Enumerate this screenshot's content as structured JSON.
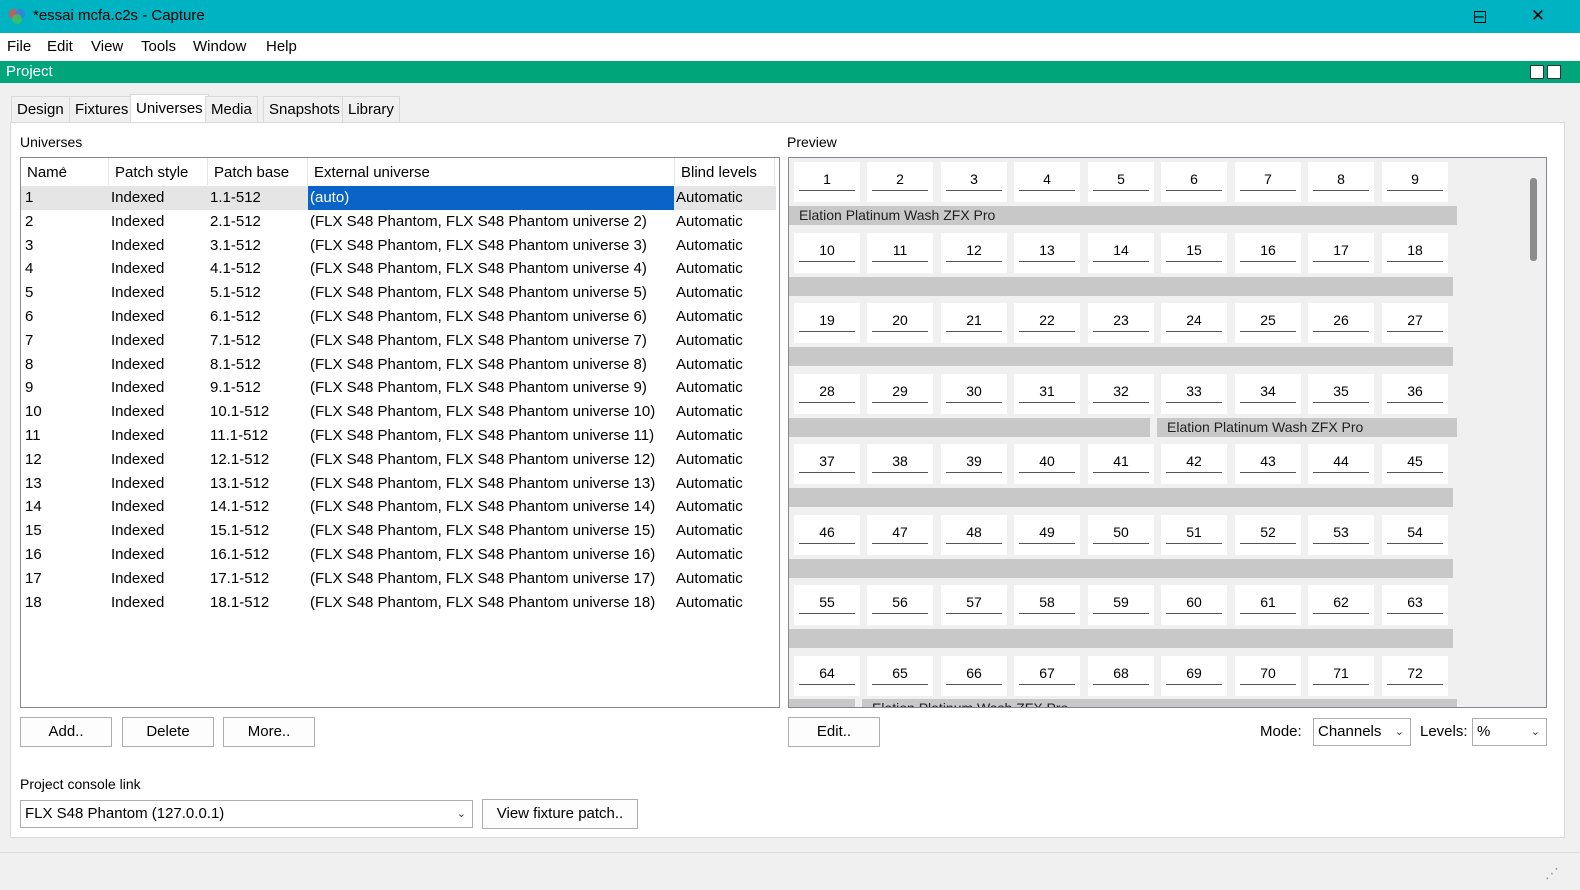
{
  "window": {
    "title": "*essai mcfa.c2s - Capture",
    "controls": [
      "–",
      "☐",
      "✕"
    ]
  },
  "menu": [
    "File",
    "Edit",
    "View",
    "Tools",
    "Window",
    "Help"
  ],
  "project_bar": {
    "label": "Project"
  },
  "tabs": [
    "Design",
    "Fixtures",
    "Universes",
    "Media",
    "Snapshots",
    "Library"
  ],
  "active_tab": "Universes",
  "universes": {
    "label": "Universes",
    "columns": [
      "Name",
      "Patch style",
      "Patch base",
      "External universe",
      "Blind levels"
    ],
    "rows": [
      [
        "1",
        "Indexed",
        "1.1-512",
        "(auto)",
        "Automatic"
      ],
      [
        "2",
        "Indexed",
        "2.1-512",
        "(FLX S48 Phantom, FLX S48 Phantom universe 2)",
        "Automatic"
      ],
      [
        "3",
        "Indexed",
        "3.1-512",
        "(FLX S48 Phantom, FLX S48 Phantom universe 3)",
        "Automatic"
      ],
      [
        "4",
        "Indexed",
        "4.1-512",
        "(FLX S48 Phantom, FLX S48 Phantom universe 4)",
        "Automatic"
      ],
      [
        "5",
        "Indexed",
        "5.1-512",
        "(FLX S48 Phantom, FLX S48 Phantom universe 5)",
        "Automatic"
      ],
      [
        "6",
        "Indexed",
        "6.1-512",
        "(FLX S48 Phantom, FLX S48 Phantom universe 6)",
        "Automatic"
      ],
      [
        "7",
        "Indexed",
        "7.1-512",
        "(FLX S48 Phantom, FLX S48 Phantom universe 7)",
        "Automatic"
      ],
      [
        "8",
        "Indexed",
        "8.1-512",
        "(FLX S48 Phantom, FLX S48 Phantom universe 8)",
        "Automatic"
      ],
      [
        "9",
        "Indexed",
        "9.1-512",
        "(FLX S48 Phantom, FLX S48 Phantom universe 9)",
        "Automatic"
      ],
      [
        "10",
        "Indexed",
        "10.1-512",
        "(FLX S48 Phantom, FLX S48 Phantom universe 10)",
        "Automatic"
      ],
      [
        "11",
        "Indexed",
        "11.1-512",
        "(FLX S48 Phantom, FLX S48 Phantom universe 11)",
        "Automatic"
      ],
      [
        "12",
        "Indexed",
        "12.1-512",
        "(FLX S48 Phantom, FLX S48 Phantom universe 12)",
        "Automatic"
      ],
      [
        "13",
        "Indexed",
        "13.1-512",
        "(FLX S48 Phantom, FLX S48 Phantom universe 13)",
        "Automatic"
      ],
      [
        "14",
        "Indexed",
        "14.1-512",
        "(FLX S48 Phantom, FLX S48 Phantom universe 14)",
        "Automatic"
      ],
      [
        "15",
        "Indexed",
        "15.1-512",
        "(FLX S48 Phantom, FLX S48 Phantom universe 15)",
        "Automatic"
      ],
      [
        "16",
        "Indexed",
        "16.1-512",
        "(FLX S48 Phantom, FLX S48 Phantom universe 16)",
        "Automatic"
      ],
      [
        "17",
        "Indexed",
        "17.1-512",
        "(FLX S48 Phantom, FLX S48 Phantom universe 17)",
        "Automatic"
      ],
      [
        "18",
        "Indexed",
        "18.1-512",
        "(FLX S48 Phantom, FLX S48 Phantom universe 18)",
        "Automatic"
      ]
    ],
    "buttons": {
      "add": "Add..",
      "delete": "Delete",
      "more": "More.."
    }
  },
  "preview": {
    "label": "Preview",
    "channels": [
      "1",
      "2",
      "3",
      "4",
      "5",
      "6",
      "7",
      "8",
      "9",
      "10",
      "11",
      "12",
      "13",
      "14",
      "15",
      "16",
      "17",
      "18",
      "19",
      "20",
      "21",
      "22",
      "23",
      "24",
      "25",
      "26",
      "27",
      "28",
      "29",
      "30",
      "31",
      "32",
      "33",
      "34",
      "35",
      "36",
      "37",
      "38",
      "39",
      "40",
      "41",
      "42",
      "43",
      "44",
      "45",
      "46",
      "47",
      "48",
      "49",
      "50",
      "51",
      "52",
      "53",
      "54",
      "55",
      "56",
      "57",
      "58",
      "59",
      "60",
      "61",
      "62",
      "63",
      "64",
      "65",
      "66",
      "67",
      "68",
      "69",
      "70",
      "71",
      "72"
    ],
    "fixture_name": "Elation Platinum Wash ZFX Pro",
    "edit_button": "Edit..",
    "mode_label": "Mode:",
    "mode_value": "Channels",
    "levels_label": "Levels:",
    "levels_value": "%"
  },
  "console_link": {
    "label": "Project console link",
    "value": "FLX S48 Phantom (127.0.0.1)",
    "view_button": "View fixture patch.."
  },
  "colors": {
    "titlebar": "#00b3c3",
    "projectbar": "#00a57a",
    "selection": "#0a64c8"
  }
}
